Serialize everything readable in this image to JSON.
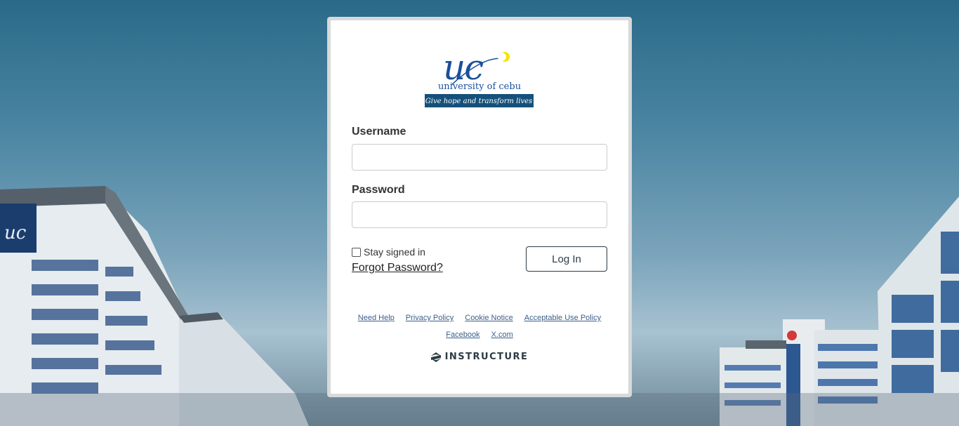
{
  "logo": {
    "mark": "UC",
    "name": "university of cebu",
    "tagline": "Give hope and transform lives"
  },
  "form": {
    "username_label": "Username",
    "username_value": "",
    "password_label": "Password",
    "password_value": "",
    "stay_signed_in_label": "Stay signed in",
    "forgot_password_label": "Forgot Password?",
    "login_button_label": "Log In"
  },
  "footer": {
    "links_row1": [
      "Need Help",
      "Privacy Policy",
      "Cookie Notice",
      "Acceptable Use Policy"
    ],
    "links_row2": [
      "Facebook",
      "X.com"
    ],
    "brand": "INSTRUCTURE"
  },
  "colors": {
    "brand_blue": "#1a4f9c",
    "tagline_bg": "#15507a",
    "link": "#3b5f8a",
    "accent_yellow": "#f4e400"
  }
}
